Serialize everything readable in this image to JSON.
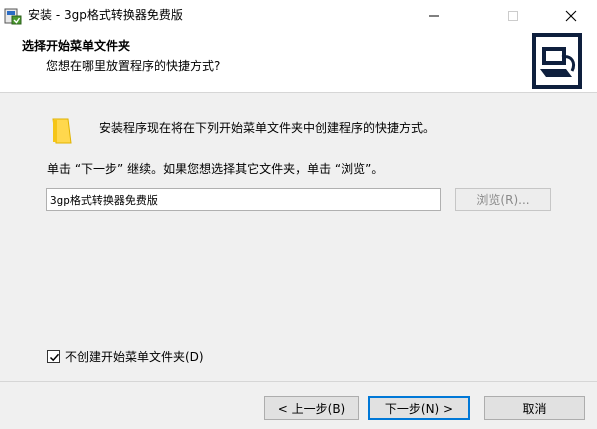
{
  "window": {
    "title": "安装 - 3gp格式转换器免费版",
    "controls": {
      "minimize_icon": "minimize-icon",
      "maximize_icon": "maximize-icon",
      "close_icon": "close-icon"
    }
  },
  "header": {
    "title": "选择开始菜单文件夹",
    "subtitle": "您想在哪里放置程序的快捷方式?"
  },
  "body": {
    "info_text": "安装程序现在将在下列开始菜单文件夹中创建程序的快捷方式。",
    "instruction_text": "单击 “下一步” 继续。如果您想选择其它文件夹，单击 “浏览”。",
    "folder_input_value": "3gp格式转换器免费版",
    "browse_label": "浏览(R)...",
    "checkbox_label": "不创建开始菜单文件夹(D)",
    "checkbox_checked": true
  },
  "footer": {
    "back_label": "< 上一步(B)",
    "next_label": "下一步(N) >",
    "cancel_label": "取消"
  },
  "colors": {
    "accent": "#0078d7",
    "header_bg": "#ffffff",
    "window_bg": "#f0f0f0",
    "folder_icon": "#ffd84d"
  }
}
